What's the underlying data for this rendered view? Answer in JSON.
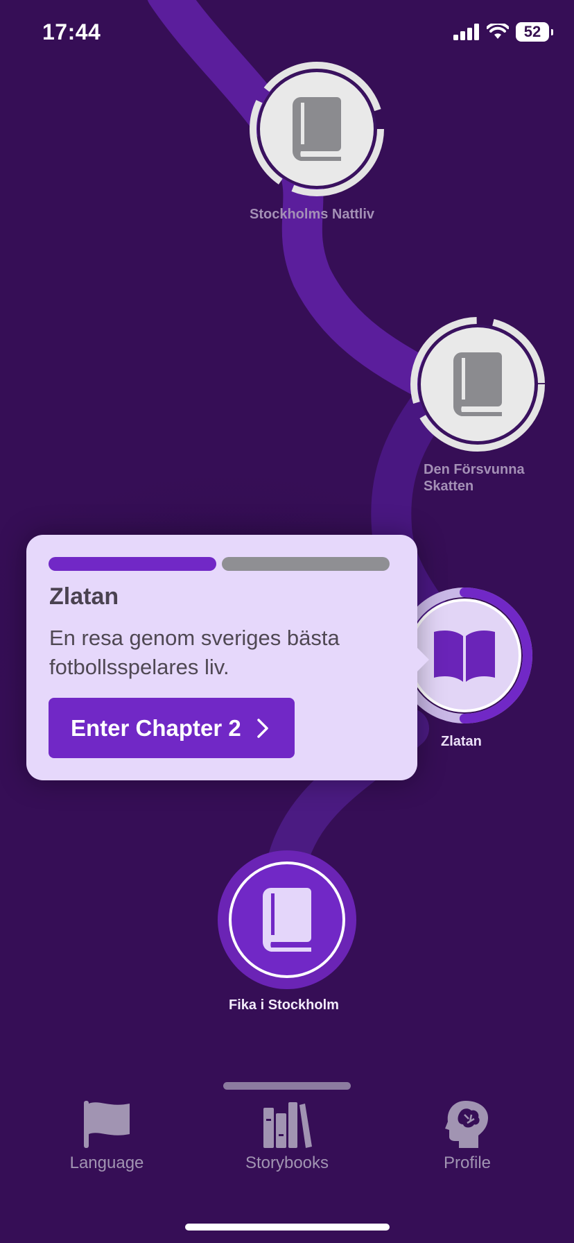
{
  "status_bar": {
    "time": "17:44",
    "battery": "52"
  },
  "colors": {
    "background": "#360e56",
    "path": "#5b1e9c",
    "accent": "#7128c6",
    "locked_ring": "#e4e4e4",
    "popup_bg": "#e6d8fb",
    "progress_inactive": "#8f8f93"
  },
  "nodes": [
    {
      "label_lines": [
        "Stockholms Nattliv"
      ],
      "state": "locked",
      "icon": "book-icon"
    },
    {
      "label_lines": [
        "Den Försvunna",
        "Skatten"
      ],
      "state": "locked",
      "icon": "book-icon"
    },
    {
      "label_lines": [
        "Zlatan"
      ],
      "state": "current",
      "icon": "open-book-icon",
      "progress": 0.5
    },
    {
      "label_lines": [
        "Fika i Stockholm"
      ],
      "state": "completed",
      "icon": "book-icon"
    }
  ],
  "popup": {
    "progress_segments": [
      {
        "state": "completed",
        "color": "#7128c6"
      },
      {
        "state": "remaining",
        "color": "#8f8f93"
      }
    ],
    "title": "Zlatan",
    "description": "En resa genom sveriges bästa fotbollsspelares liv.",
    "button_label": "Enter Chapter 2",
    "button_icon": "chevron-right-icon"
  },
  "bottom_nav": [
    {
      "label": "Language",
      "icon": "flag-icon"
    },
    {
      "label": "Storybooks",
      "icon": "books-icon"
    },
    {
      "label": "Profile",
      "icon": "brain-head-icon"
    }
  ]
}
